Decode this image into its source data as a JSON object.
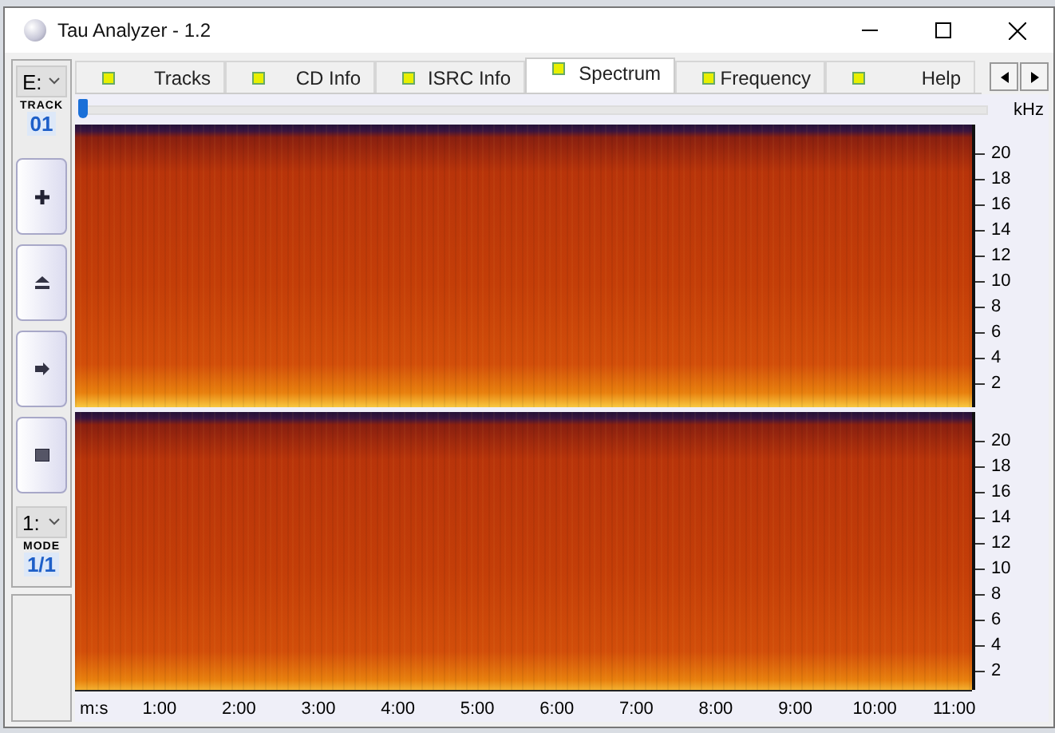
{
  "window": {
    "title": "Tau Analyzer - 1.2"
  },
  "sidebar": {
    "drive": "E:",
    "track_label": "TRACK",
    "track": "01",
    "buttons": [
      {
        "kind": "plus"
      },
      {
        "kind": "eject"
      },
      {
        "kind": "next"
      },
      {
        "kind": "stop"
      }
    ],
    "mode_select": "1:",
    "mode_label": "MODE",
    "mode": "1/1"
  },
  "tabs": [
    {
      "label": "Tracks",
      "selected": false
    },
    {
      "label": "CD Info",
      "selected": false
    },
    {
      "label": "ISRC Info",
      "selected": false
    },
    {
      "label": "Spectrum",
      "selected": true
    },
    {
      "label": "Frequency",
      "selected": false
    },
    {
      "label": "Help",
      "selected": false
    }
  ],
  "position": {
    "level": 0
  },
  "spectrum": {
    "unit": "kHz",
    "channels": [
      {
        "ticks": [
          "20",
          "18",
          "16",
          "14",
          "12",
          "10",
          "8",
          "6",
          "4",
          "2"
        ]
      },
      {
        "ticks": [
          "20",
          "18",
          "16",
          "14",
          "12",
          "10",
          "8",
          "6",
          "4",
          "2"
        ]
      }
    ],
    "time_ticks": [
      "m:s",
      "1:00",
      "2:00",
      "3:00",
      "4:00",
      "5:00",
      "6:00",
      "7:00",
      "8:00",
      "9:00",
      "10:00",
      "11:00"
    ]
  }
}
